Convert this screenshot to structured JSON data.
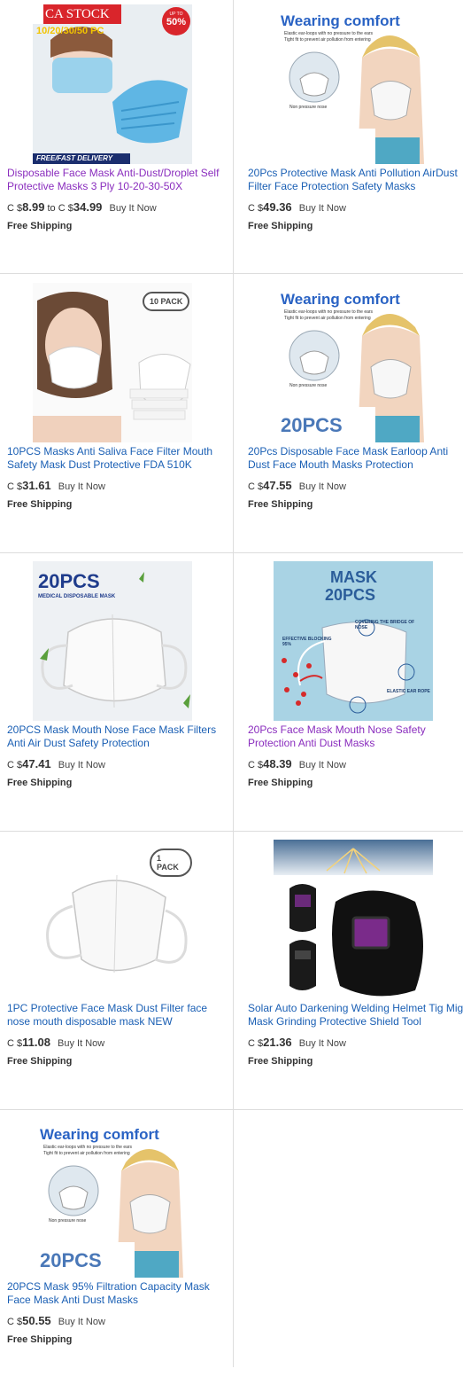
{
  "colors": {
    "link": "#1a5fb4",
    "visited": "#8a2dbe",
    "divider": "#dddddd"
  },
  "items": [
    {
      "title": "Disposable Face Mask Anti-Dust/Droplet Self Protective Masks 3 Ply 10-20-30-50X",
      "visited": true,
      "currency": "C $",
      "price": "8.99",
      "to_text": "to",
      "currency2": "C $",
      "price2": "34.99",
      "buy": "Buy It Now",
      "shipping": "Free Shipping",
      "image": {
        "icon": "surgical-mask-image",
        "banner": "CA STOCK",
        "sub": "10/20/30/50 PC",
        "badge_top": "UP TO",
        "badge": "50%",
        "footer": "FREE/FAST DELIVERY"
      }
    },
    {
      "title": "20Pcs Protective Mask Anti Pollution AirDust Filter Face Protection Safety Masks",
      "visited": false,
      "currency": "C $",
      "price": "49.36",
      "buy": "Buy It Now",
      "shipping": "Free Shipping",
      "image": {
        "icon": "cup-mask-image",
        "heading": "Wearing comfort",
        "note1": "Elastic ear-loops with no pressure to the ears",
        "note2": "Tight fit to prevent air pollution from entering",
        "caption": "Non pressure nose"
      }
    },
    {
      "title": "10PCS Masks Anti Saliva Face Filter Mouth Safety Mask Dust Protective FDA 510K",
      "visited": false,
      "currency": "C $",
      "price": "31.61",
      "buy": "Buy It Now",
      "shipping": "Free Shipping",
      "image": {
        "icon": "kn95-mask-woman-image",
        "badge": "10 PACK"
      }
    },
    {
      "title": "20Pcs Disposable Face Mask Earloop Anti Dust Face Mouth Masks Protection",
      "visited": false,
      "currency": "C $",
      "price": "47.55",
      "buy": "Buy It Now",
      "shipping": "Free Shipping",
      "image": {
        "icon": "cup-mask-image",
        "heading": "Wearing comfort",
        "note1": "Elastic ear-loops with no pressure to the ears",
        "note2": "Tight fit to prevent air pollution from entering",
        "caption": "Non pressure nose",
        "count": "20PCS"
      }
    },
    {
      "title": "20PCS Mask Mouth Nose Face Mask Filters Anti Air Dust Safety Protection",
      "visited": false,
      "currency": "C $",
      "price": "47.41",
      "buy": "Buy It Now",
      "shipping": "Free Shipping",
      "image": {
        "icon": "kn95-mask-image",
        "count": "20PCS",
        "sub": "MEDICAL DISPOSABLE MASK"
      }
    },
    {
      "title": "20Pcs Face Mask Mouth Nose Safety Protection Anti Dust Masks",
      "visited": true,
      "currency": "C $",
      "price": "48.39",
      "buy": "Buy It Now",
      "shipping": "Free Shipping",
      "image": {
        "icon": "kn95-mask-diagram-image",
        "heading1": "MASK",
        "heading2": "20PCS",
        "f1": "COVERING THE BRIDGE OF NOSE",
        "f2": "EFFECTIVE BLOCKING 95%",
        "f3": "ELASTIC EAR ROPE"
      }
    },
    {
      "title": "1PC Protective Face Mask Dust Filter face nose mouth disposable mask NEW",
      "visited": false,
      "currency": "C $",
      "price": "11.08",
      "buy": "Buy It Now",
      "shipping": "Free Shipping",
      "image": {
        "icon": "kn95-mask-image",
        "badge": "1 PACK"
      }
    },
    {
      "title": "Solar Auto Darkening Welding Helmet Tig Mig Mask Grinding Protective Shield Tool",
      "visited": false,
      "currency": "C $",
      "price": "21.36",
      "buy": "Buy It Now",
      "shipping": "Free Shipping",
      "image": {
        "icon": "welding-helmet-image"
      }
    },
    {
      "title": "20PCS Mask 95% Filtration Capacity Mask Face Mask Anti Dust Masks",
      "visited": false,
      "currency": "C $",
      "price": "50.55",
      "buy": "Buy It Now",
      "shipping": "Free Shipping",
      "image": {
        "icon": "cup-mask-image",
        "heading": "Wearing comfort",
        "note1": "Elastic ear-loops with no pressure to the ears",
        "note2": "Tight fit to prevent air pollution from entering",
        "caption": "Non pressure nose",
        "count": "20PCS"
      }
    }
  ]
}
